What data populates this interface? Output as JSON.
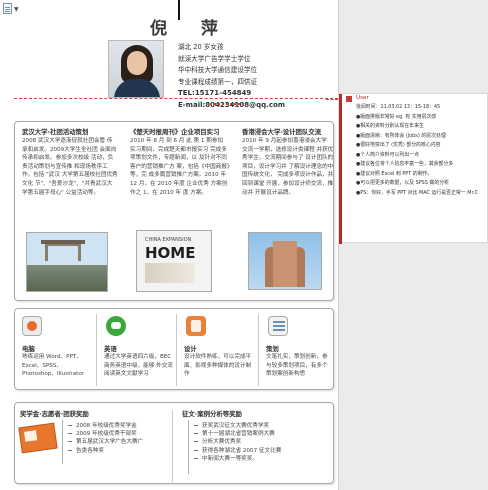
{
  "header": {
    "name": "倪 萍",
    "info": [
      "湖北 20 岁女孩",
      "就读大学广告学学士学位",
      "华中科技大学通信建设学位",
      "专业课程成绩第一，四供证",
      "TEL:15171-454849",
      "E-mail:804234108@qq.com"
    ]
  },
  "cards": [
    {
      "title": "武汉大学·社团活动策划",
      "text": "2008 武汉大学逐渐促就社团会管 传承和启发。2009大学生全社团 会面向传承和启发。参加多次校级 活动，负责活动策划与宣传推 和现场秩序工作。包括 \"武汉 大学第五届校社团优秀文化 节\"、\"吾爱沙龙\"、\"共青武汉大 学第五届字母心\" 公益活动等。"
    },
    {
      "title": "《楚天时报周刊》企业项目实习",
      "text": "2010 年 8 月 到 6 月 此 第 1 期参加 实习期间，完成楚天都市报实习 完成多项策划文件，专题新闻，以 及针对不同客户的营销推广方 案，包括《中国商报》等，完 成多篇营销推广方案。2010 年 12 月，在 2010 年度 企业优秀 方案创作之 1，在 2010 年 度 方案。"
    },
    {
      "title": "香港浸会大学·设计团队交流",
      "text": "2010 年 9 月起参加香港浸会大学 交流一学期，选修设计类课程 并获优秀学生，交流期间参与了 设计团队的项目，设计学习并 了解设计理念的中国传统文化， 完成多项设计作品，并回到课堂 开展，参加设计师交流，推动并 开展设计品牌。"
    }
  ],
  "picture": {
    "magazine_small": "CHINA EXPANSION",
    "magazine_title": "HOME"
  },
  "skills": [
    {
      "title": "电脑",
      "text": "熟练运用 Word、PPT、Excel、SPSS、Photoshop、Illustrator"
    },
    {
      "title": "英语",
      "text": "通过大学英语四六级，BEC 商务英语中级，能够 外交流阅读英文文献学习"
    },
    {
      "title": "设计",
      "text": "设计软件熟练，可以完成平面、影视多种媒体的设计制作"
    },
    {
      "title": "策划",
      "text": "文笔扎实，策划创新，参与较多策划项目，有多个策划案创新构思"
    }
  ],
  "awards": {
    "title": "奖学金·志愿者·团获奖励",
    "items": [
      "2008 年校级优秀奖学金",
      "2009 年校级优秀干部奖",
      "第五届武汉大学广告大赛广",
      "告类各种奖"
    ]
  },
  "awards2": {
    "title": "征文·案例分析等奖励",
    "items": [
      "获奖武汉征文大赛优秀学奖",
      "第十一届湖北省营销案例大赛",
      "分析大赛优秀奖",
      "获得各种湖北省 2007 征文比赛",
      "中新闻大赛一等奖奖。"
    ]
  },
  "comment": {
    "user": "User",
    "lines": [
      "批阅时间：11.03.02 13：15-18：45",
      "●版面排版非常好 eg. 有 实用层次感",
      "●相关的资料分别从现在年来生",
      "●版面清晰：有所体会 (Jobs) 的层次处理",
      "●很好地突出了 (优秀) 部分的核心内容",
      "●个人简介资料可以列出一点",
      "●建议各位将个人信息丰富一些，其余部分多",
      "●建议对照 Excel 到 PPT 的制作。",
      "●可以把更多的数据，以及 SPSS 做的分析",
      "●PS：你好，手写 PPT 对比 MAC 运行是否正常一 Mr.C"
    ]
  }
}
